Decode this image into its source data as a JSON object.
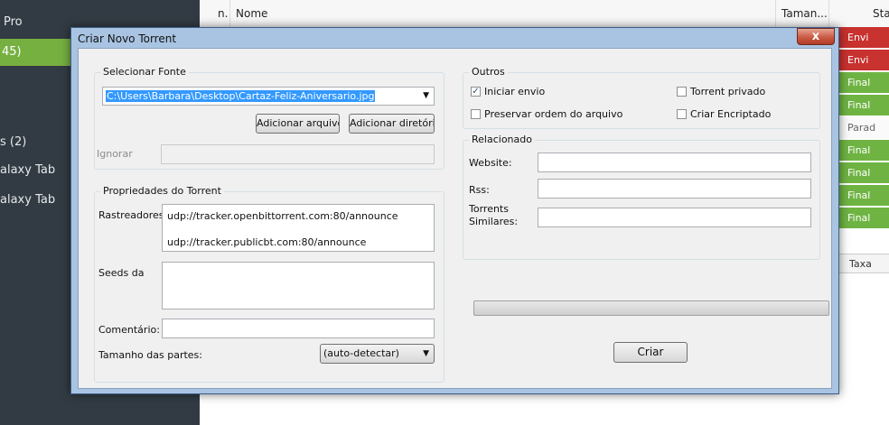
{
  "sidebar": {
    "items": [
      {
        "label": "Pro",
        "active": false
      },
      {
        "label": "45)",
        "active": true
      },
      {
        "label": "s (2)",
        "active": false
      },
      {
        "label": "alaxy Tab",
        "active": false
      },
      {
        "label": "alaxy Tab",
        "active": false
      }
    ]
  },
  "list": {
    "columns": [
      "n.",
      "Nome",
      "Taman...",
      "Sta"
    ],
    "statuses": [
      {
        "text": "Envi",
        "color": "#c8322f"
      },
      {
        "text": "Envi",
        "color": "#c8322f"
      },
      {
        "text": "Final",
        "color": "#6fb443"
      },
      {
        "text": "Final",
        "color": "#6fb443"
      },
      {
        "text": "Parad",
        "color": "#fafafa"
      },
      {
        "text": "Final",
        "color": "#6fb443"
      },
      {
        "text": "Final",
        "color": "#6fb443"
      },
      {
        "text": "Final",
        "color": "#6fb443"
      },
      {
        "text": "Final",
        "color": "#6fb443"
      }
    ],
    "detail_column": "Taxa"
  },
  "dialog": {
    "title": "Criar Novo Torrent",
    "close_label": "x",
    "source": {
      "group_title": "Selecionar Fonte",
      "path": "C:\\Users\\Barbara\\Desktop\\Cartaz-Feliz-Aniversario.jpg",
      "add_file_label": "Adicionar arquivo",
      "add_dir_label": "Adicionar diretório",
      "ignore_label": "Ignorar",
      "ignore_value": ""
    },
    "properties": {
      "group_title": "Propriedades do Torrent",
      "trackers_label": "Rastreadores:",
      "trackers": [
        "udp://tracker.openbittorrent.com:80/announce",
        "udp://tracker.publicbt.com:80/announce"
      ],
      "seeds_label": "Seeds da",
      "seeds_value": "",
      "comment_label": "Comentário:",
      "comment_value": "",
      "piece_size_label": "Tamanho das partes:",
      "piece_size_value": "(auto-detectar)"
    },
    "others": {
      "group_title": "Outros",
      "options": [
        {
          "label": "Iniciar envio",
          "checked": true
        },
        {
          "label": "Torrent privado",
          "checked": false
        },
        {
          "label": "Preservar ordem do arquivo",
          "checked": false
        },
        {
          "label": "Criar Encriptado",
          "checked": false
        }
      ]
    },
    "related": {
      "group_title": "Relacionado",
      "website_label": "Website:",
      "website_value": "",
      "rss_label": "Rss:",
      "rss_value": "",
      "similar_label_line1": "Torrents",
      "similar_label_line2": "Similares:",
      "similar_value": ""
    },
    "progress": 0,
    "create_label": "Criar"
  }
}
